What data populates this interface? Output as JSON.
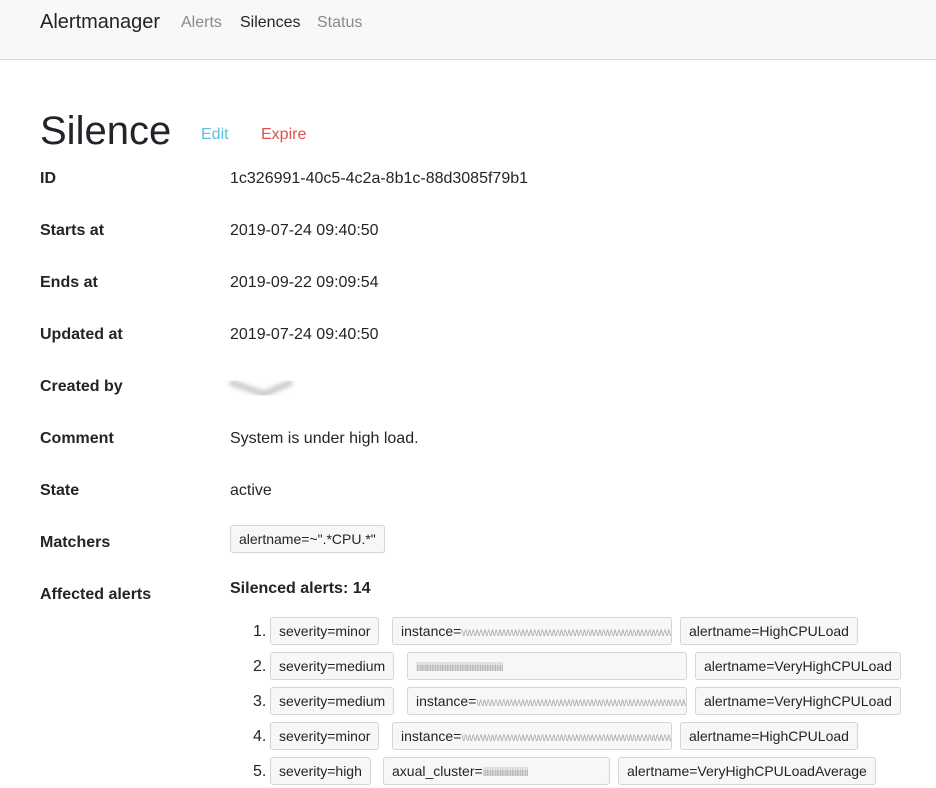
{
  "app": {
    "name": "Alertmanager"
  },
  "nav": {
    "alerts": "Alerts",
    "silences": "Silences",
    "status": "Status"
  },
  "silence": {
    "title": "Silence",
    "edit_label": "Edit",
    "expire_label": "Expire",
    "fields": {
      "id_label": "ID",
      "id_value": "1c326991-40c5-4c2a-8b1c-88d3085f79b1",
      "starts_label": "Starts at",
      "starts_value": "2019-07-24 09:40:50",
      "ends_label": "Ends at",
      "ends_value": "2019-09-22 09:09:54",
      "updated_label": "Updated at",
      "updated_value": "2019-07-24 09:40:50",
      "created_label": "Created by",
      "comment_label": "Comment",
      "comment_value": "System is under high load.",
      "state_label": "State",
      "state_value": "active",
      "matchers_label": "Matchers",
      "matcher_1": "alertname=~\".*CPU.*\"",
      "affected_label": "Affected alerts"
    },
    "silenced_alerts_title": "Silenced alerts: 14",
    "alerts": [
      {
        "num": "1.",
        "severity": "severity=minor",
        "instance_prefix": "instance=",
        "instance_mask": "wwwwwwwwwwwwwwwwwwwwwwwwwwwww",
        "alertname": "alertname=HighCPULoad"
      },
      {
        "num": "2.",
        "severity": "severity=medium",
        "instance_prefix": "",
        "instance_mask": "iiiiiiiiiiiiiiiiiiiiiiiiiiiiiiiiiiiiiiiiiiiiiiiiiiii",
        "alertname": "alertname=VeryHighCPULoad"
      },
      {
        "num": "3.",
        "severity": "severity=medium",
        "instance_prefix": "instance=",
        "instance_mask": "wwwwwwwwwwwwwwwwwwwwwwwwwwwww",
        "alertname": "alertname=VeryHighCPULoad"
      },
      {
        "num": "4.",
        "severity": "severity=minor",
        "instance_prefix": "instance=",
        "instance_mask": "wwwwwwwwwwwwwwwwwwwwwwwwwwwww",
        "alertname": "alertname=HighCPULoad"
      },
      {
        "num": "5.",
        "severity": "severity=high",
        "instance_prefix": "axual_cluster=",
        "instance_mask": "iiiiiiiiiiiiiiiiiiiiiiiiiii",
        "alertname": "alertname=VeryHighCPULoadAverage"
      }
    ]
  },
  "colors": {
    "edit": "#5bc0de",
    "expire": "#d9534f",
    "navbar_bg": "#f8f8f8"
  }
}
